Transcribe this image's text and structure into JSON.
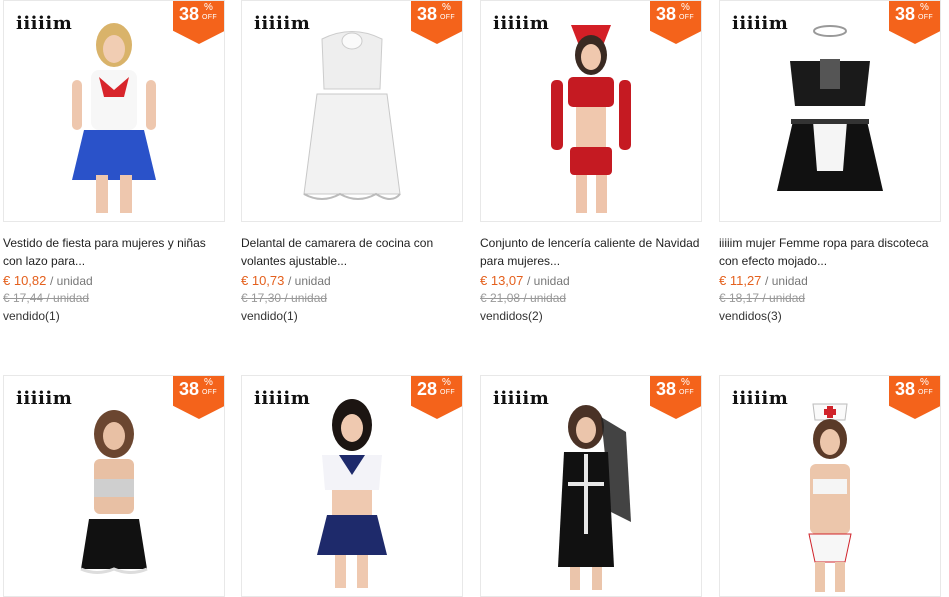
{
  "products": [
    {
      "brand": "iiiiim",
      "discount": "38",
      "percent": "%",
      "off": "OFF",
      "title": "Vestido de fiesta para mujeres y niñas con lazo para...",
      "price": "€ 10,82",
      "unit": "/ unidad",
      "old_price": "€ 17,44 / unidad",
      "sold": "vendido(1)"
    },
    {
      "brand": "iiiiim",
      "discount": "38",
      "percent": "%",
      "off": "OFF",
      "title": "Delantal de camarera de cocina con volantes ajustable...",
      "price": "€ 10,73",
      "unit": "/ unidad",
      "old_price": "€ 17,30 / unidad",
      "sold": "vendido(1)"
    },
    {
      "brand": "iiiiim",
      "discount": "38",
      "percent": "%",
      "off": "OFF",
      "title": "Conjunto de lencería caliente de Navidad para mujeres...",
      "price": "€ 13,07",
      "unit": "/ unidad",
      "old_price": "€ 21,08 / unidad",
      "sold": "vendidos(2)"
    },
    {
      "brand": "iiiiim",
      "discount": "38",
      "percent": "%",
      "off": "OFF",
      "title": "iiiiim mujer Femme ropa para discoteca con efecto mojado...",
      "price": "€ 11,27",
      "unit": "/ unidad",
      "old_price": "€ 18,17 / unidad",
      "sold": "vendidos(3)"
    },
    {
      "brand": "iiiiim",
      "discount": "38",
      "percent": "%",
      "off": "OFF"
    },
    {
      "brand": "iiiiim",
      "discount": "28",
      "percent": "%",
      "off": "OFF"
    },
    {
      "brand": "iiiiim",
      "discount": "38",
      "percent": "%",
      "off": "OFF"
    },
    {
      "brand": "iiiiim",
      "discount": "38",
      "percent": "%",
      "off": "OFF"
    }
  ],
  "colors": {
    "accent": "#f4631b",
    "price": "#e4601d"
  }
}
